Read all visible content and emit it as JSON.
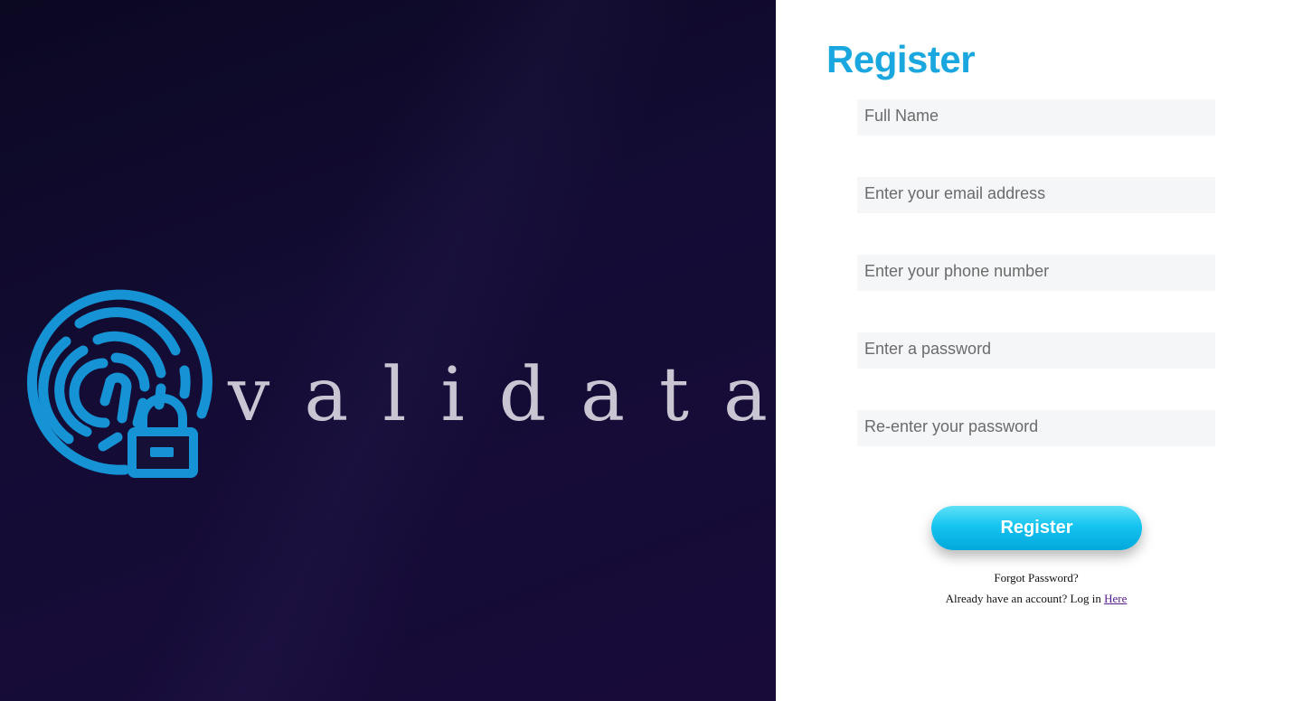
{
  "brand": {
    "wordmark": "validata",
    "logo_icon": "fingerprint-lock-icon",
    "logo_color": "#1593d4",
    "background_color": "#140c35"
  },
  "form": {
    "title": "Register",
    "title_color": "#1aa7df",
    "fields": {
      "full_name": {
        "placeholder": "Full Name",
        "value": ""
      },
      "email": {
        "placeholder": "Enter your email address",
        "value": ""
      },
      "phone": {
        "placeholder": "Enter your phone number",
        "value": ""
      },
      "password": {
        "placeholder": "Enter a password",
        "value": ""
      },
      "confirm_password": {
        "placeholder": "Re-enter your password",
        "value": ""
      }
    },
    "submit_label": "Register",
    "button_color": "#15c4f0",
    "forgot_password": "Forgot Password?",
    "login_prompt": "Already have an account? Log in",
    "login_link": "Here"
  }
}
